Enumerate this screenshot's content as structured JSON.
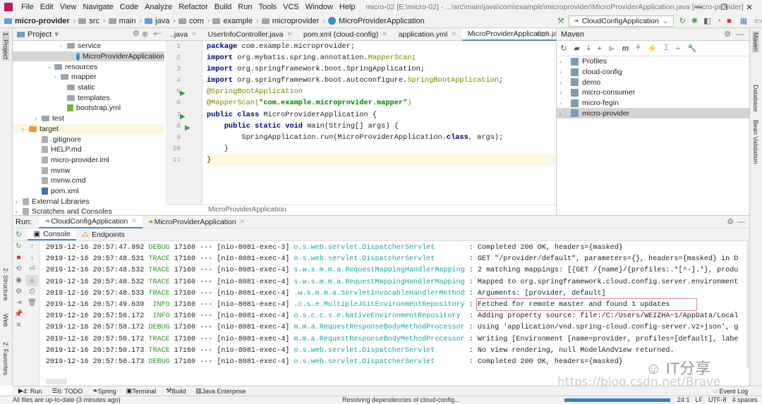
{
  "window": {
    "title": "micro-02 [E:\\micro-02] - ...\\src\\main\\java\\com\\example\\microprovider\\MicroProviderApplication.java [micro-provider]",
    "minimize": "—",
    "restore": "❐",
    "close": "✕"
  },
  "menu": [
    "File",
    "Edit",
    "View",
    "Navigate",
    "Code",
    "Analyze",
    "Refactor",
    "Build",
    "Run",
    "Tools",
    "VCS",
    "Window",
    "Help"
  ],
  "breadcrumb": [
    "micro-provider",
    "src",
    "main",
    "java",
    "com",
    "example",
    "microprovider",
    "MicroProviderApplication"
  ],
  "run_config": {
    "selected": "CloudConfigApplication"
  },
  "project": {
    "title": "Project",
    "side_tab": "1: Project",
    "tree": [
      {
        "label": "service",
        "indent": 7,
        "arrow": "›",
        "icon": "folder"
      },
      {
        "label": "MicroProviderApplication",
        "indent": 9,
        "arrow": "",
        "icon": "class",
        "selected": true
      },
      {
        "label": "resources",
        "indent": 5,
        "arrow": "⌄",
        "icon": "folder"
      },
      {
        "label": "mapper",
        "indent": 6,
        "arrow": "›",
        "icon": "folder"
      },
      {
        "label": "static",
        "indent": 7,
        "arrow": "",
        "icon": "folder"
      },
      {
        "label": "templates",
        "indent": 7,
        "arrow": "",
        "icon": "folder"
      },
      {
        "label": "bootstrap.yml",
        "indent": 7,
        "arrow": "",
        "icon": "yml"
      },
      {
        "label": "test",
        "indent": 3,
        "arrow": "›",
        "icon": "folder"
      },
      {
        "label": "target",
        "indent": 1,
        "arrow": "›",
        "icon": "folder-orange",
        "highlight": true
      },
      {
        "label": ".gitignore",
        "indent": 3,
        "arrow": "",
        "icon": "file"
      },
      {
        "label": "HELP.md",
        "indent": 3,
        "arrow": "",
        "icon": "file"
      },
      {
        "label": "micro-provider.iml",
        "indent": 3,
        "arrow": "",
        "icon": "file"
      },
      {
        "label": "mvnw",
        "indent": 3,
        "arrow": "",
        "icon": "file"
      },
      {
        "label": "mvnw.cmd",
        "indent": 3,
        "arrow": "",
        "icon": "file"
      },
      {
        "label": "pom.xml",
        "indent": 3,
        "arrow": "",
        "icon": "maven"
      },
      {
        "label": "External Libraries",
        "indent": 0,
        "arrow": "›",
        "icon": "lib"
      },
      {
        "label": "Scratches and Consoles",
        "indent": 0,
        "arrow": "›",
        "icon": "lib"
      }
    ]
  },
  "editor": {
    "tabs": [
      {
        "label": "..java",
        "active": false
      },
      {
        "label": "UserInfoController.java",
        "active": false
      },
      {
        "label": "pom.xml (cloud-config)",
        "active": false
      },
      {
        "label": "application.yml",
        "active": false
      },
      {
        "label": "MicroProviderApplication.jav",
        "active": true
      }
    ],
    "tabs_overflow": "5",
    "line_numbers": [
      "1",
      "2",
      "3",
      "4",
      "5",
      "6",
      "7",
      "8",
      "9",
      "10",
      "11"
    ],
    "code": [
      [
        [
          "package ",
          "kw"
        ],
        [
          "com.example.microprovider;",
          ""
        ]
      ],
      [
        [
          "import ",
          "kw"
        ],
        [
          "org.mybatis.spring.annotation.",
          ""
        ],
        [
          "MapperScan",
          "an"
        ],
        [
          ";",
          ""
        ]
      ],
      [
        [
          "import ",
          "kw"
        ],
        [
          "org.springframework.boot.SpringApplication;",
          ""
        ]
      ],
      [
        [
          "import ",
          "kw"
        ],
        [
          "org.springframework.boot.autoconfigure.",
          ""
        ],
        [
          "SpringBootApplication",
          "an"
        ],
        [
          ";",
          ""
        ]
      ],
      [
        [
          "@SpringBootApplication",
          "an"
        ]
      ],
      [
        [
          "@MapperScan(",
          "an"
        ],
        [
          "\"com.example.microprovider.mapper\"",
          "st"
        ],
        [
          ")",
          "an"
        ]
      ],
      [
        [
          "public class ",
          "kw"
        ],
        [
          "MicroProviderApplication {",
          ""
        ]
      ],
      [
        [
          "    public static void ",
          "kw"
        ],
        [
          "main(String[] args) {",
          ""
        ]
      ],
      [
        [
          "        SpringApplication.",
          ""
        ],
        [
          "run",
          "it"
        ],
        [
          "(MicroProviderApplication.",
          ""
        ],
        [
          "class",
          "kw"
        ],
        [
          ", args);",
          ""
        ]
      ],
      [
        [
          "    }",
          ""
        ]
      ],
      [
        [
          "}",
          ""
        ]
      ]
    ],
    "current_line": 11,
    "breadcrumb": "MicroProviderApplication"
  },
  "maven": {
    "title": "Maven",
    "items": [
      {
        "label": "Profiles"
      },
      {
        "label": "cloud-config"
      },
      {
        "label": "demo"
      },
      {
        "label": "micro-consumer"
      },
      {
        "label": "micro-fegin"
      },
      {
        "label": "micro-provider",
        "selected": true
      }
    ]
  },
  "right_tabs": [
    "Maven",
    "Database",
    "Bean Validation"
  ],
  "left_tabs": [
    "2: Structure",
    "Web",
    "2: Favorites"
  ],
  "run": {
    "label": "Run:",
    "tabs": [
      {
        "label": "CloudConfigApplication",
        "active": true
      },
      {
        "label": "MicroProviderApplication",
        "active": false
      }
    ],
    "subtabs": [
      "Console",
      "Endpoints"
    ],
    "log": [
      [
        "2019-12-16 20:57:47.992",
        "DEBUG",
        "17160",
        "[nio-8081-exec-3]",
        "o.s.web.servlet.DispatcherServlet       ",
        ": Completed 200 OK, headers={masked}"
      ],
      [
        "2019-12-16 20:57:48.531",
        "TRACE",
        "17160",
        "[nio-8081-exec-4]",
        "o.s.web.servlet.DispatcherServlet       ",
        ": GET \"/provider/default\", parameters={}, headers={masked} in D"
      ],
      [
        "2019-12-16 20:57:48.532",
        "TRACE",
        "17160",
        "[nio-8081-exec-4]",
        "s.w.s.m.m.a.RequestMappingHandlerMapping",
        ": 2 matching mappings: [{GET /{name}/{profiles:.*[^-].*}, produ"
      ],
      [
        "2019-12-16 20:57:48.532",
        "TRACE",
        "17160",
        "[nio-8081-exec-4]",
        "s.w.s.m.m.a.RequestMappingHandlerMapping",
        ": Mapped to org.springframework.cloud.config.server.environment"
      ],
      [
        "2019-12-16 20:57:48.533",
        "TRACE",
        "17160",
        "[nio-8081-exec-4]",
        ".w.s.m.m.a.ServletInvocableHandlerMethod",
        ": Arguments: [provider, default]"
      ],
      [
        "2019-12-16 20:57:49.639",
        " INFO",
        "17160",
        "[nio-8081-exec-4]",
        ".c.s.e.MultipleJGitEnvironmentRepository",
        ": Fetched for remote master and found 1 updates"
      ],
      [
        "2019-12-16 20:57:50.172",
        " INFO",
        "17160",
        "[nio-8081-exec-4]",
        "o.s.c.c.s.e.NativeEnvironmentRepository ",
        ": Adding property source: file:/C:/Users/WEIZHA~1/AppData/Local"
      ],
      [
        "2019-12-16 20:57:50.172",
        "DEBUG",
        "17160",
        "[nio-8081-exec-4]",
        "m.m.a.RequestResponseBodyMethodProcessor",
        ": Using 'application/vnd.spring-cloud.config-server.v2+json', g"
      ],
      [
        "2019-12-16 20:57:50.172",
        "TRACE",
        "17160",
        "[nio-8081-exec-4]",
        "m.m.a.RequestResponseBodyMethodProcessor",
        ": Writing [Environment [name=provider, profiles=[default], labe"
      ],
      [
        "2019-12-16 20:57:50.173",
        "TRACE",
        "17160",
        "[nio-8081-exec-4]",
        "o.s.web.servlet.DispatcherServlet       ",
        ": No view rendering, null ModelAndView returned."
      ],
      [
        "2019-12-16 20:57:50.173",
        "DEBUG",
        "17160",
        "[nio-8081-exec-4]",
        "o.s.web.servlet.DispatcherServlet       ",
        ": Completed 200 OK, headers={masked}"
      ]
    ]
  },
  "bottom_tools": [
    "4: Run",
    "6: TODO",
    "Spring",
    "Terminal",
    "Build",
    "Java Enterprise"
  ],
  "event_log": "Event Log",
  "status": {
    "left": "All files are up-to-date (3 minutes ago)",
    "center": "Resolving dependencies of cloud-config...",
    "position": "24:1",
    "line_sep": "LF",
    "encoding": "UTF-8",
    "indent": "4 spaces"
  },
  "watermark": "https://blog.csdn.net/Brave_",
  "logo_text": "IT分享"
}
